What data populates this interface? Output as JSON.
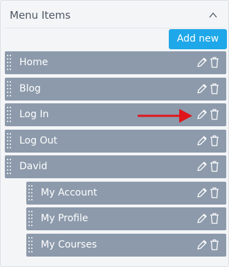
{
  "panel": {
    "title": "Menu Items",
    "collapse_icon": "chevron-up-icon",
    "add_button_label": "Add new"
  },
  "items": [
    {
      "label": "Home"
    },
    {
      "label": "Blog"
    },
    {
      "label": "Log In"
    },
    {
      "label": "Log Out"
    },
    {
      "label": "David"
    }
  ],
  "children": [
    {
      "label": "My Account"
    },
    {
      "label": "My Profile"
    },
    {
      "label": "My Courses"
    }
  ],
  "colors": {
    "item_background": "#8c9aab",
    "button_background": "#1ea7e9",
    "annotation_arrow": "#e0151b"
  }
}
